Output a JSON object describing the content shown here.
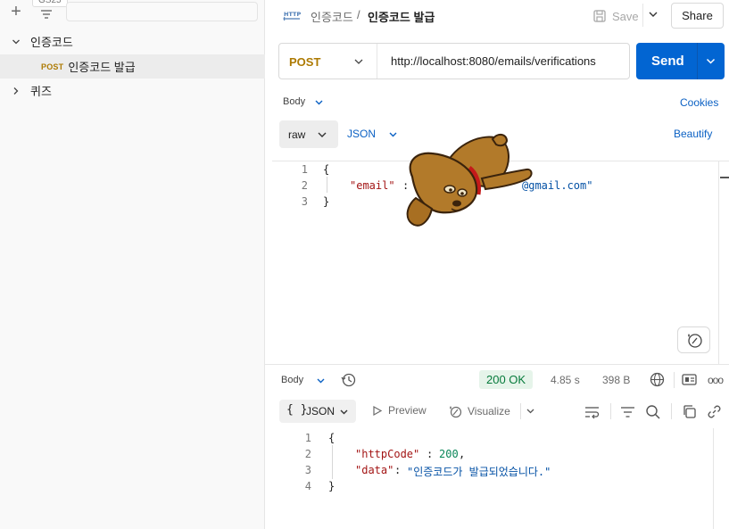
{
  "sidebar": {
    "tooltip_fragment": "GS25",
    "items": [
      {
        "label": "인증코드",
        "expanded": true
      },
      {
        "method": "POST",
        "label": "인증코드 발급",
        "selected": true
      },
      {
        "label": "퀴즈",
        "expanded": false
      }
    ]
  },
  "header": {
    "breadcrumb_parent": "인증코드",
    "breadcrumb_separator": "/",
    "breadcrumb_current": "인증코드 발급",
    "save_label": "Save",
    "share_label": "Share"
  },
  "request": {
    "method": "POST",
    "url": "http://localhost:8080/emails/verifications",
    "send_label": "Send",
    "body_tab_label": "Body",
    "cookies_label": "Cookies",
    "body_type": "raw",
    "body_format": "JSON",
    "beautify_label": "Beautify",
    "code_lines": [
      {
        "num": "1",
        "text": "{"
      },
      {
        "num": "2",
        "key": "\"email\"",
        "colon": ":",
        "value_tail": "@gmail.com\""
      },
      {
        "num": "3",
        "text": "}"
      }
    ]
  },
  "response": {
    "body_tab_label": "Body",
    "status": "200 OK",
    "time": "4.85 s",
    "size": "398 B",
    "format": "JSON",
    "format_braces": "{ }",
    "preview_label": "Preview",
    "visualize_label": "Visualize",
    "more_label": "ooo",
    "code_lines": [
      {
        "num": "1",
        "text": "{"
      },
      {
        "num": "2",
        "key": "\"httpCode\"",
        "colon": ": ",
        "value": "200",
        "tail": ","
      },
      {
        "num": "3",
        "key": "\"data\"",
        "colon": ": ",
        "value": "\"인증코드가 발급되었습니다.\""
      },
      {
        "num": "4",
        "text": "}"
      }
    ]
  },
  "colors": {
    "accent_blue": "#0265d2",
    "method_post": "#ad7a03",
    "status_ok_bg": "#e6f4ea",
    "status_ok_text": "#067a3b",
    "link_blue": "#0b61c4"
  },
  "icons": [
    "plus-icon",
    "filter-icon",
    "chevron-down-icon",
    "chevron-right-icon",
    "http-icon",
    "save-icon",
    "history-icon",
    "globe-icon",
    "save-response-icon",
    "more-icon",
    "play-icon",
    "visualize-icon",
    "wrap-icon",
    "filter-lines-icon",
    "search-icon",
    "copy-icon",
    "link-icon",
    "ai-assist-icon",
    "dog-sticker"
  ]
}
